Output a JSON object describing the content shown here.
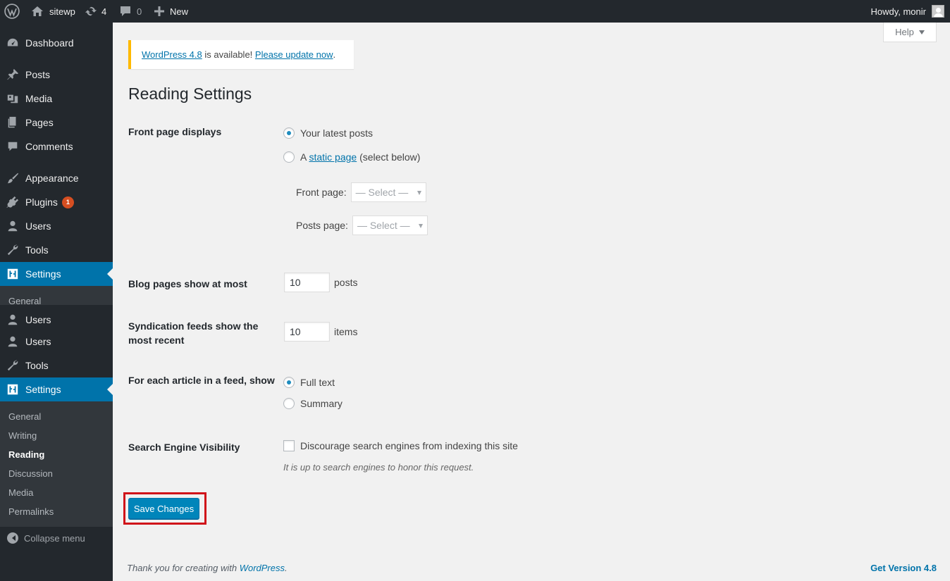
{
  "admin_bar": {
    "site_name": "sitewp",
    "updates_count": "4",
    "comments_count": "0",
    "new_label": "New",
    "greeting": "Howdy, monir"
  },
  "sidebar": {
    "items": [
      {
        "label": "Dashboard",
        "icon": "dashboard-icon"
      },
      {
        "label": "Posts",
        "icon": "pin-icon"
      },
      {
        "label": "Media",
        "icon": "media-icon"
      },
      {
        "label": "Pages",
        "icon": "pages-icon"
      },
      {
        "label": "Comments",
        "icon": "comment-icon"
      },
      {
        "label": "Appearance",
        "icon": "brush-icon"
      },
      {
        "label": "Plugins",
        "icon": "plugin-icon",
        "badge": "1"
      },
      {
        "label": "Users",
        "icon": "user-icon"
      },
      {
        "label": "Tools",
        "icon": "wrench-icon"
      },
      {
        "label": "Settings",
        "icon": "settings-icon"
      },
      {
        "label": "General"
      },
      {
        "label": "Users",
        "icon": "user-icon"
      },
      {
        "label": "Users",
        "icon": "user-icon"
      },
      {
        "label": "Tools",
        "icon": "wrench-icon"
      },
      {
        "label": "Settings",
        "icon": "settings-icon"
      }
    ],
    "submenu": [
      "General",
      "Writing",
      "Reading",
      "Discussion",
      "Media",
      "Permalinks"
    ],
    "collapse_label": "Collapse menu"
  },
  "help_label": "Help",
  "notice": {
    "link1": "WordPress 4.8",
    "text": " is available! ",
    "link2": "Please update now",
    "end": "."
  },
  "page_title": "Reading Settings",
  "form": {
    "front_page": {
      "label": "Front page displays",
      "option_latest": "Your latest posts",
      "option_static_prefix": "A ",
      "option_static_link": "static page",
      "option_static_suffix": " (select below)",
      "front_page_label": "Front page:",
      "posts_page_label": "Posts page:",
      "select_placeholder": "— Select —"
    },
    "blog_pages": {
      "label": "Blog pages show at most",
      "value": "10",
      "unit": "posts"
    },
    "syndication": {
      "label": "Syndication feeds show the most recent",
      "value": "10",
      "unit": "items"
    },
    "feed_article": {
      "label": "For each article in a feed, show",
      "option_full": "Full text",
      "option_summary": "Summary"
    },
    "search_visibility": {
      "label": "Search Engine Visibility",
      "checkbox": "Discourage search engines from indexing this site",
      "description": "It is up to search engines to honor this request."
    },
    "save_button": "Save Changes"
  },
  "footer": {
    "thanks_prefix": "Thank you for creating with ",
    "thanks_link": "WordPress",
    "thanks_suffix": ".",
    "version": "Get Version 4.8"
  },
  "colors": {
    "accent": "#0073aa",
    "sidebar_bg": "#23282d",
    "notice_border": "#ffb900",
    "highlight_box": "#d0141a"
  }
}
